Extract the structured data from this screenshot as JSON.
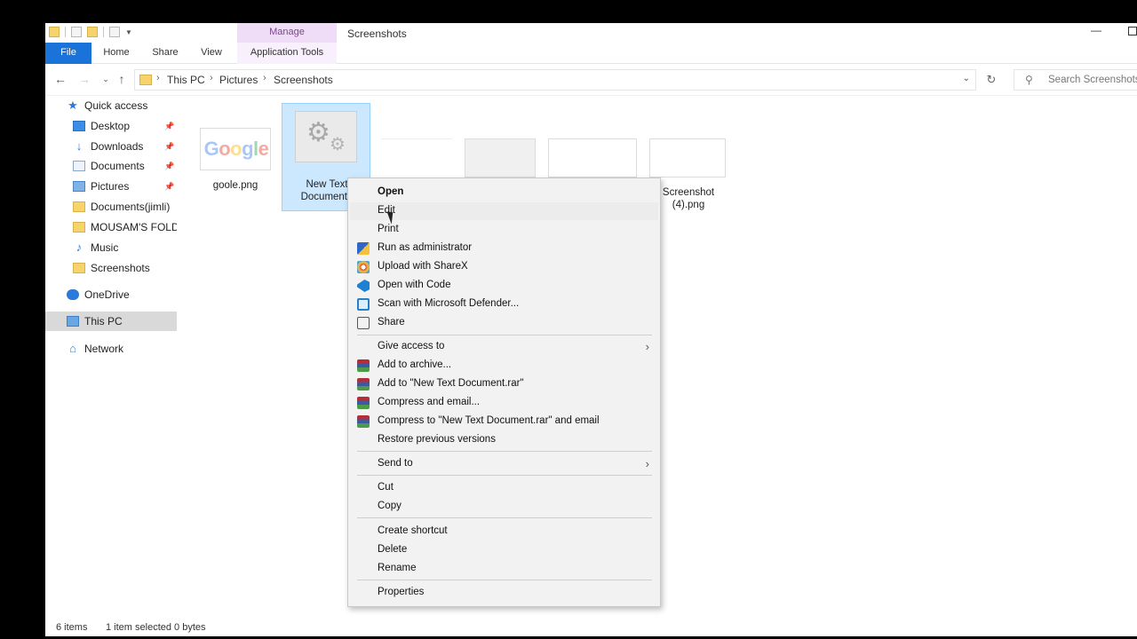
{
  "titlebar": {
    "manage_tab": "Manage",
    "title": "Screenshots"
  },
  "ribbon": {
    "tabs": [
      "File",
      "Home",
      "Share",
      "View",
      "Application Tools"
    ]
  },
  "address": {
    "crumbs": [
      "This PC",
      "Pictures",
      "Screenshots"
    ],
    "search_placeholder": "Search Screenshots"
  },
  "nav": {
    "items": [
      {
        "label": "Quick access",
        "icon": "star-icon",
        "pinned": false
      },
      {
        "label": "Desktop",
        "icon": "desktop-icon",
        "pinned": true
      },
      {
        "label": "Downloads",
        "icon": "download-icon",
        "pinned": true
      },
      {
        "label": "Documents",
        "icon": "documents-icon",
        "pinned": true
      },
      {
        "label": "Pictures",
        "icon": "pictures-icon",
        "pinned": true
      },
      {
        "label": "Documents(jimli)",
        "icon": "folder-icon",
        "pinned": false
      },
      {
        "label": "MOUSAM'S FOLDEI",
        "icon": "folder-icon",
        "pinned": false
      },
      {
        "label": "Music",
        "icon": "music-icon",
        "pinned": false
      },
      {
        "label": "Screenshots",
        "icon": "folder-icon",
        "pinned": false
      },
      {
        "label": "OneDrive",
        "icon": "onedrive-icon",
        "pinned": false
      },
      {
        "label": "This PC",
        "icon": "this-pc-icon",
        "pinned": false
      },
      {
        "label": "Network",
        "icon": "network-icon",
        "pinned": false
      }
    ]
  },
  "files": [
    {
      "name": "goole.png",
      "thumb_text": "Google"
    },
    {
      "name": "New Text Document.t",
      "selected": true
    },
    {
      "name": ""
    },
    {
      "name": ""
    },
    {
      "name": ""
    },
    {
      "name": "Screenshot (4).png"
    }
  ],
  "context_menu": {
    "items": [
      {
        "label": "Open",
        "bold": true
      },
      {
        "label": "Edit"
      },
      {
        "label": "Print"
      },
      {
        "label": "Run as administrator",
        "icon": "shield-icon"
      },
      {
        "label": "Upload with ShareX",
        "icon": "sharex-icon"
      },
      {
        "label": "Open with Code",
        "icon": "vscode-icon"
      },
      {
        "label": "Scan with Microsoft Defender...",
        "icon": "defender-icon"
      },
      {
        "label": "Share",
        "icon": "share-icon"
      },
      {
        "label": "Give access to",
        "submenu": true
      },
      {
        "label": "Add to archive...",
        "icon": "winrar-icon"
      },
      {
        "label": "Add to \"New Text Document.rar\"",
        "icon": "winrar-icon"
      },
      {
        "label": "Compress and email...",
        "icon": "winrar-icon"
      },
      {
        "label": "Compress to \"New Text Document.rar\" and email",
        "icon": "winrar-icon"
      },
      {
        "label": "Restore previous versions"
      },
      {
        "label": "Send to",
        "submenu": true
      },
      {
        "label": "Cut"
      },
      {
        "label": "Copy"
      },
      {
        "label": "Create shortcut"
      },
      {
        "label": "Delete"
      },
      {
        "label": "Rename"
      },
      {
        "label": "Properties"
      }
    ]
  },
  "status": {
    "items_count": "6 items",
    "selection": "1 item selected  0 bytes"
  }
}
